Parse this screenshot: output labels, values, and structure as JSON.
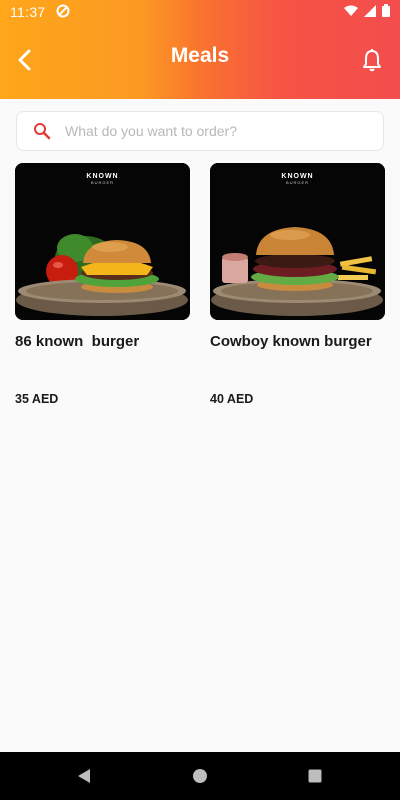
{
  "status_bar": {
    "time": "11:37"
  },
  "header": {
    "title": "Meals"
  },
  "search": {
    "placeholder": "What do you want to order?"
  },
  "meals": [
    {
      "name": "86 known  burger",
      "price": "35 AED",
      "brand": "KNOWN",
      "brand_sub": "BURGER"
    },
    {
      "name": "Cowboy known burger",
      "price": "40 AED",
      "brand": "KNOWN",
      "brand_sub": "BURGER"
    }
  ],
  "colors": {
    "gradient_start": "#ffa61a",
    "gradient_end": "#f34d4d",
    "accent": "#e53935"
  }
}
